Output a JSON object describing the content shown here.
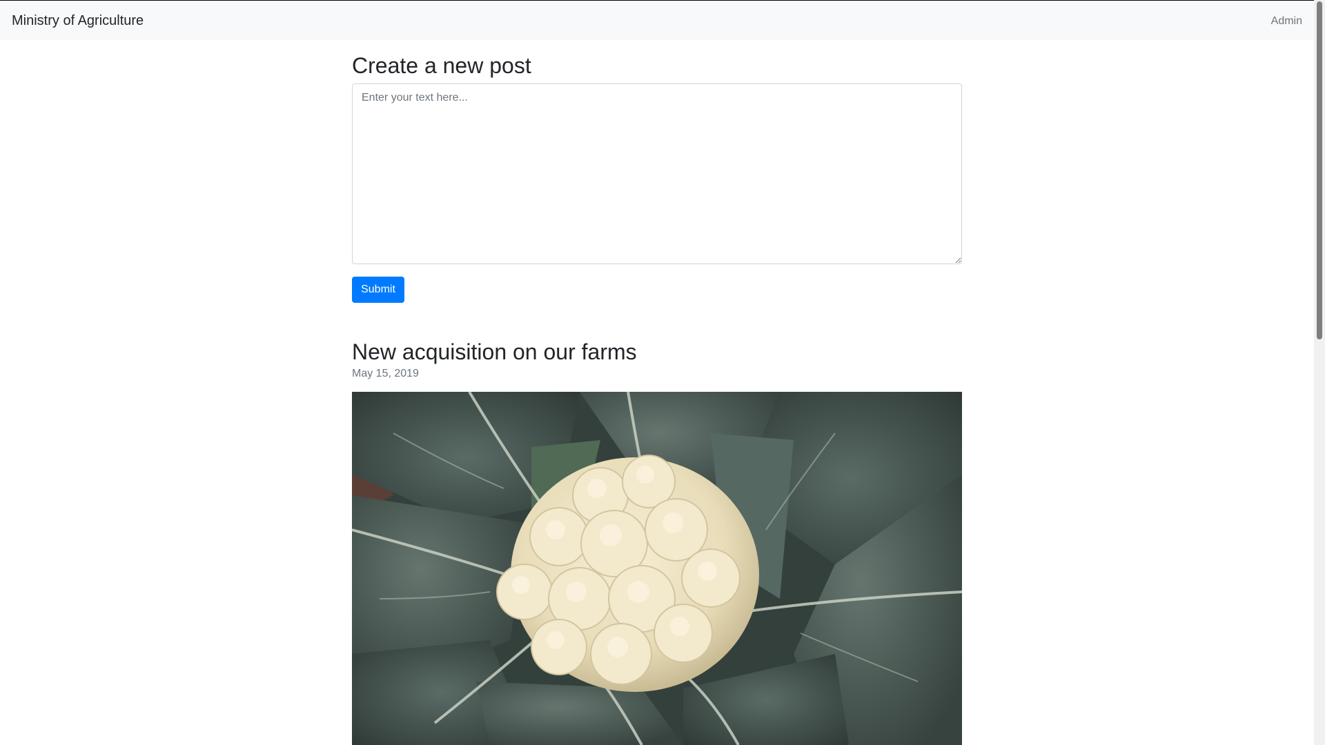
{
  "navbar": {
    "brand": "Ministry of Agriculture",
    "admin_link": "Admin",
    "background": "#f8f9fa"
  },
  "form": {
    "title": "Create a new post",
    "textarea_placeholder": "Enter your text here...",
    "submit_label": "Submit",
    "accent": "#007bff"
  },
  "post": {
    "title": "New acquisition on our farms",
    "date": "May 15, 2019",
    "image_alt": "cauliflower-photo"
  }
}
